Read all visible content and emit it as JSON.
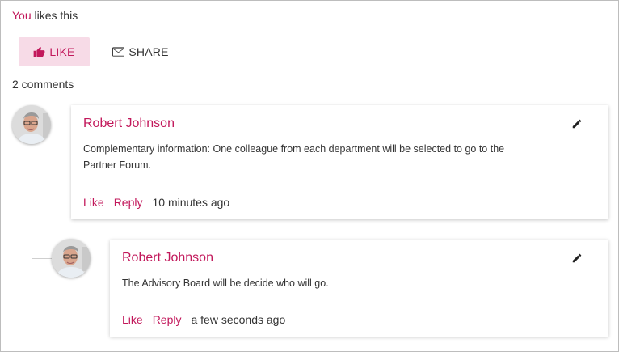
{
  "likes": {
    "actor": "You",
    "suffix": " likes this"
  },
  "buttons": {
    "like": "LIKE",
    "share": "SHARE"
  },
  "comments_count": "2 comments",
  "comments": [
    {
      "author": "Robert Johnson",
      "text": "Complementary information: One colleague from each department will be selected to go to the Partner Forum.",
      "like": "Like",
      "reply": "Reply",
      "time": "10 minutes ago"
    },
    {
      "author": "Robert Johnson",
      "text": "The Advisory Board will be decide who will go.",
      "like": "Like",
      "reply": "Reply",
      "time": "a few seconds ago"
    }
  ],
  "colors": {
    "accent": "#c2185b",
    "like_bg": "#f7dbe7"
  },
  "icons": [
    "thumbs-up-icon",
    "envelope-icon",
    "pencil-icon"
  ]
}
